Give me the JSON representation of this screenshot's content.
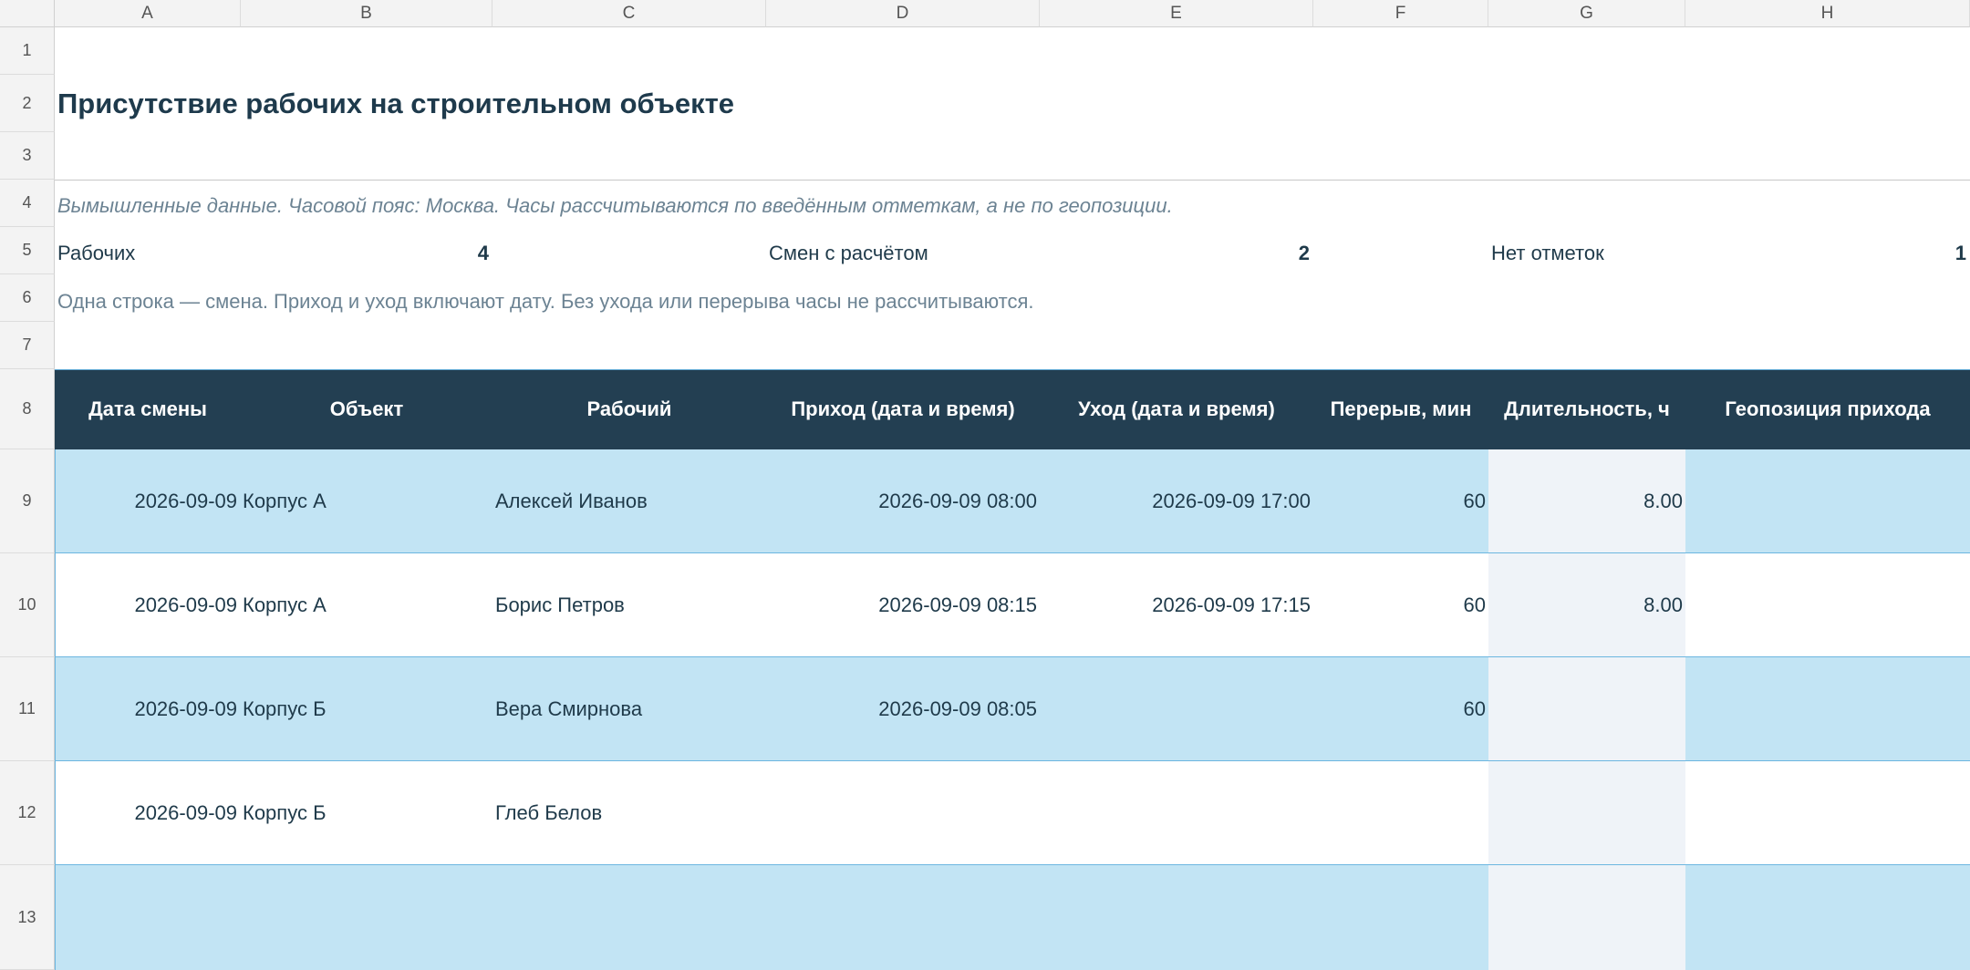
{
  "columns": [
    "A",
    "B",
    "C",
    "D",
    "E",
    "F",
    "G",
    "H"
  ],
  "rows": [
    "1",
    "2",
    "3",
    "4",
    "5",
    "6",
    "7",
    "8",
    "9",
    "10",
    "11",
    "12",
    "13"
  ],
  "title": "Присутствие рабочих на строительном объекте",
  "note": "Вымышленные данные. Часовой пояс: Москва. Часы рассчитываются по введённым отметкам, а не по геопозиции.",
  "summary": {
    "workers_label": "Рабочих",
    "workers_value": "4",
    "shifts_label": "Смен с расчётом",
    "shifts_value": "2",
    "nomarks_label": "Нет отметок",
    "nomarks_value": "1"
  },
  "instruction": "Одна строка — смена. Приход и уход включают дату. Без ухода или перерыва часы не рассчитываются.",
  "headers": [
    "Дата смены",
    "Объект",
    "Рабочий",
    "Приход (дата и время)",
    "Уход (дата и время)",
    "Перерыв, мин",
    "Длительность, ч",
    "Геопозиция прихода"
  ],
  "data_rows": [
    {
      "date": "2026-09-09",
      "object": "Корпус А",
      "worker": "Алексей Иванов",
      "arrival": "2026-09-09 08:00",
      "departure": "2026-09-09 17:00",
      "break": "60",
      "duration": "8.00",
      "geo": ""
    },
    {
      "date": "2026-09-09",
      "object": "Корпус А",
      "worker": "Борис Петров",
      "arrival": "2026-09-09 08:15",
      "departure": "2026-09-09 17:15",
      "break": "60",
      "duration": "8.00",
      "geo": ""
    },
    {
      "date": "2026-09-09",
      "object": "Корпус Б",
      "worker": "Вера Смирнова",
      "arrival": "2026-09-09 08:05",
      "departure": "",
      "break": "60",
      "duration": "",
      "geo": ""
    },
    {
      "date": "2026-09-09",
      "object": "Корпус Б",
      "worker": "Глеб Белов",
      "arrival": "",
      "departure": "",
      "break": "",
      "duration": "",
      "geo": ""
    },
    {
      "date": "",
      "object": "",
      "worker": "",
      "arrival": "",
      "departure": "",
      "break": "",
      "duration": "",
      "geo": ""
    }
  ],
  "colors": {
    "header_bg": "#233f52",
    "band_blue": "#c2e4f4",
    "duration_col": "#eff3f8",
    "grid_line": "#6cb6e0"
  }
}
